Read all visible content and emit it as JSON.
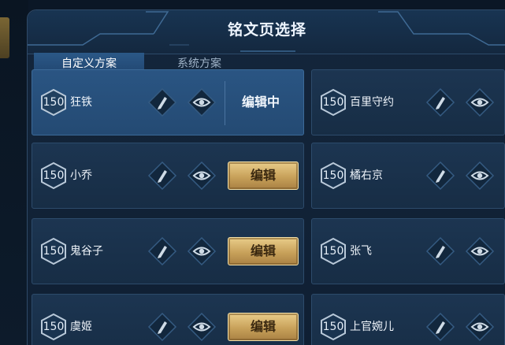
{
  "dialog": {
    "title": "铭文页选择"
  },
  "tabs": [
    {
      "label": "自定义方案",
      "active": true
    },
    {
      "label": "系统方案",
      "active": false
    }
  ],
  "pages": [
    {
      "level": "150",
      "name": "狂铁",
      "action": "编辑中",
      "selected": true
    },
    {
      "level": "150",
      "name": "百里守约"
    },
    {
      "level": "150",
      "name": "小乔",
      "action": "编辑"
    },
    {
      "level": "150",
      "name": "橘右京"
    },
    {
      "level": "150",
      "name": "鬼谷子",
      "action": "编辑"
    },
    {
      "level": "150",
      "name": "张飞"
    },
    {
      "level": "150",
      "name": "虞姬",
      "action": "编辑"
    },
    {
      "level": "150",
      "name": "上官婉儿"
    }
  ],
  "icons": {
    "rename": "pencil-icon",
    "preview": "eye-icon"
  },
  "colors": {
    "accent_gold": "#d7b46c",
    "selected_card": "#2a5583",
    "card": "#1c3551"
  }
}
